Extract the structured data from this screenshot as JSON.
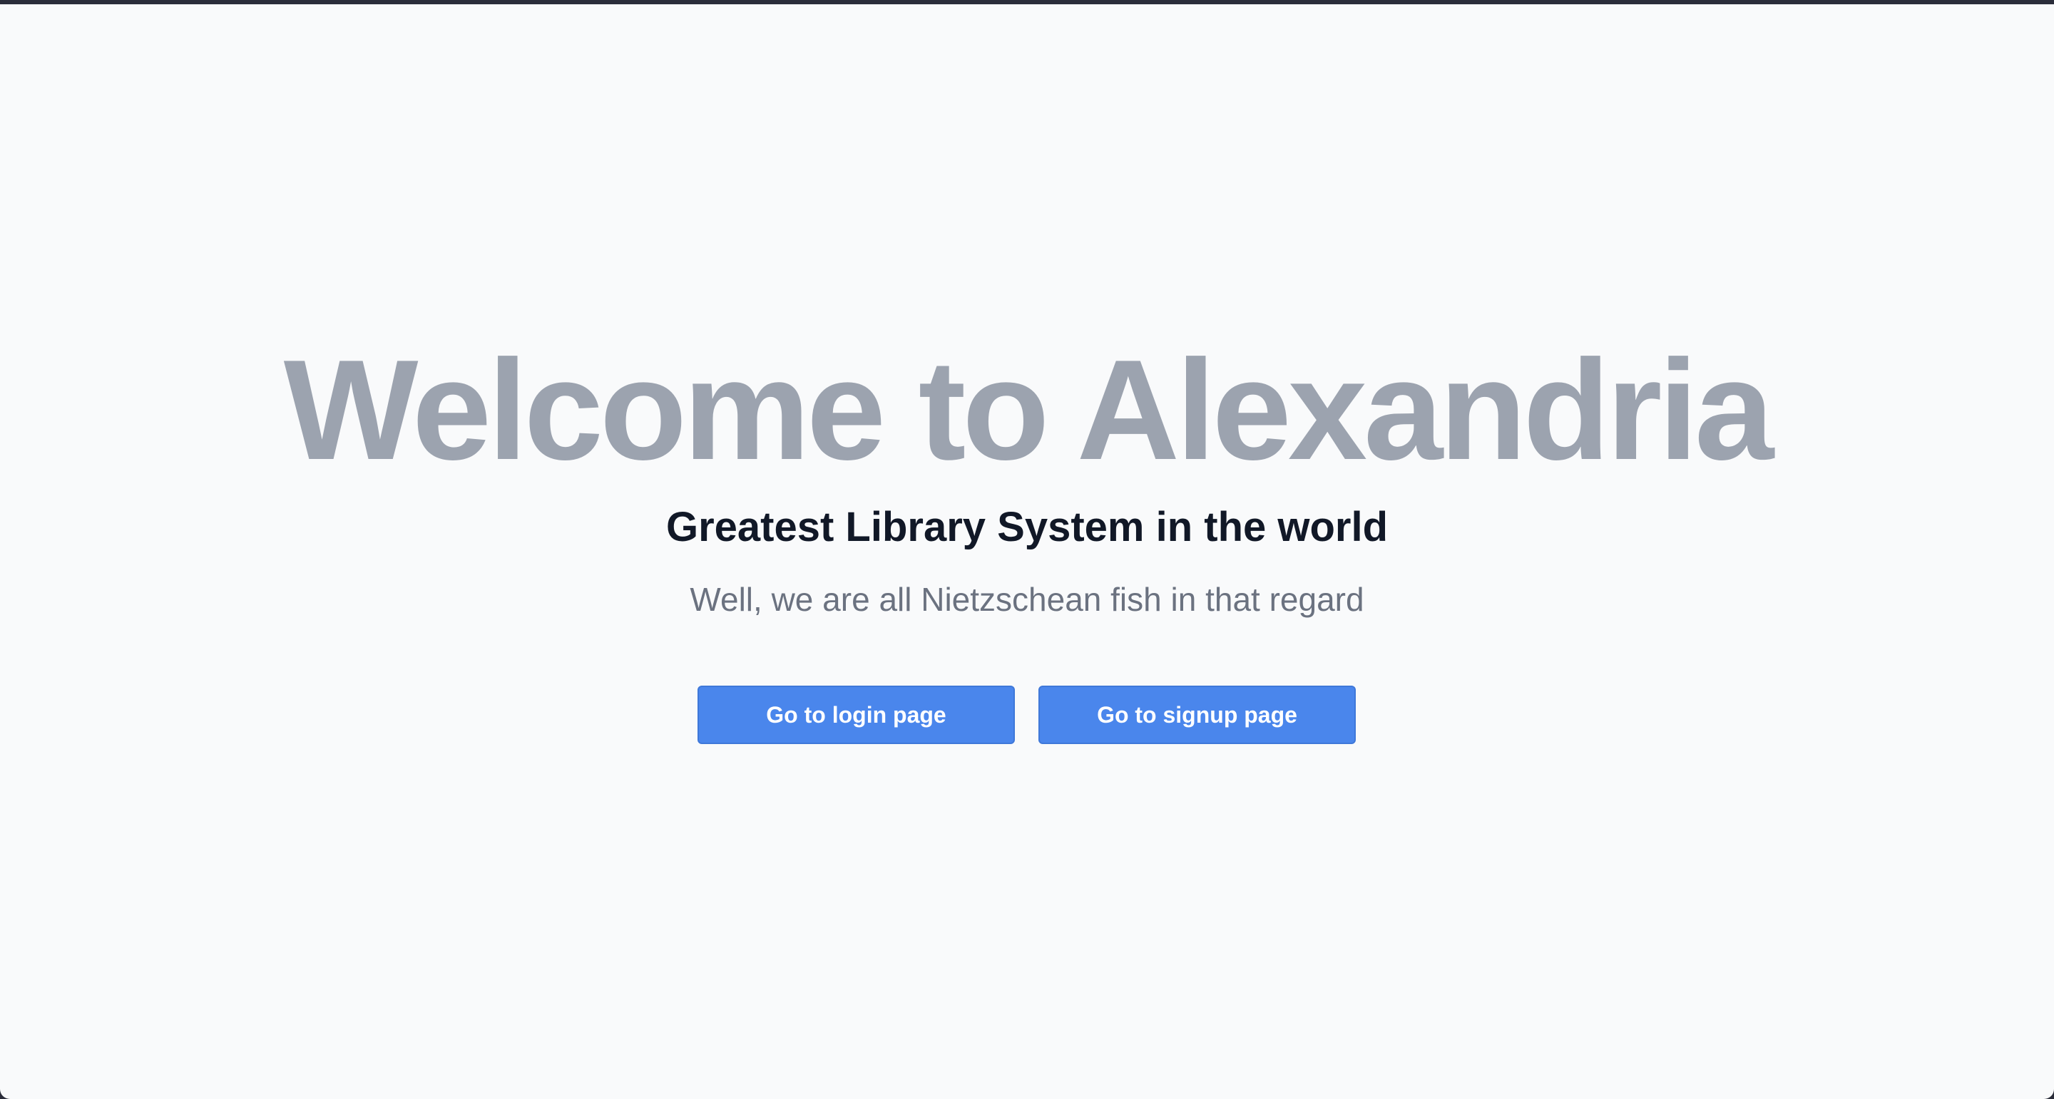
{
  "hero": {
    "title": "Welcome to Alexandria",
    "subtitle": "Greatest Library System in the world",
    "tagline": "Well, we are all Nietzschean fish in that regard"
  },
  "actions": {
    "login_label": "Go to login page",
    "signup_label": "Go to signup page"
  },
  "colors": {
    "background": "#f9fafb",
    "title": "#9ca3af",
    "subtitle": "#111827",
    "tagline": "#6b7280",
    "button": "#4a86ec"
  }
}
